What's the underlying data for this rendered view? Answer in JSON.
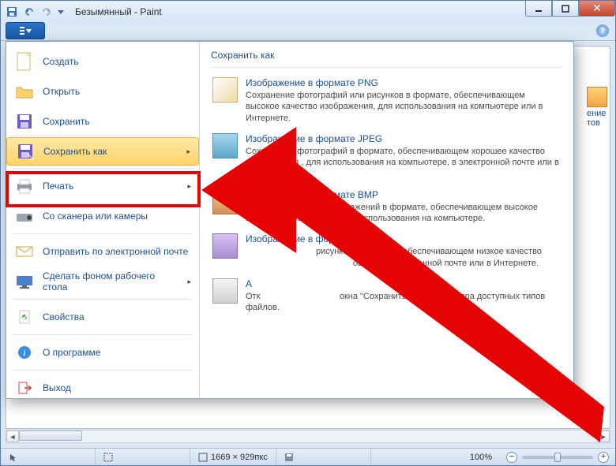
{
  "window": {
    "title": "Безымянный - Paint"
  },
  "menu": {
    "items": [
      {
        "key": "create",
        "label": "Создать"
      },
      {
        "key": "open",
        "label": "Открыть"
      },
      {
        "key": "save",
        "label": "Сохранить"
      },
      {
        "key": "saveas",
        "label": "Сохранить как",
        "hasSub": true,
        "hovered": true
      },
      {
        "key": "print",
        "label": "Печать",
        "hasSub": true
      },
      {
        "key": "scanner",
        "label": "Со сканера или камеры"
      },
      {
        "key": "email",
        "label": "Отправить по электронной почте"
      },
      {
        "key": "wallpaper",
        "label": "Сделать фоном рабочего стола",
        "hasSub": true
      },
      {
        "key": "props",
        "label": "Свойства"
      },
      {
        "key": "about",
        "label": "О программе"
      },
      {
        "key": "exit",
        "label": "Выход"
      }
    ],
    "submenu_title": "Сохранить как",
    "formats": [
      {
        "key": "png",
        "title": "Изображение в формате PNG",
        "desc": "Сохранение фотографий или рисунков в формате, обеспечивающем высокое качество изображения, для использования на компьютере или в Интернете."
      },
      {
        "key": "jpeg",
        "title": "Изображение в формате JPEG",
        "desc": "Сохранение фотографий в формате, обеспечивающем хорошее качество изображения , для использования на компьютере, в электронной почте или в Интернете."
      },
      {
        "key": "bmp",
        "title": "Изображение в формате BMP",
        "desc": "Сохранение любых изображений в формате, обеспечивающем высокое качество изображения, для использования на компьютере."
      },
      {
        "key": "gif",
        "title": "Изображение в формате GIF",
        "desc_part1": "рисунков в формате, обеспечивающем низкое качество",
        "desc_part2": "ования в электронной почте или в Интернете."
      },
      {
        "key": "other",
        "title_part1": "А",
        "desc_part1": "Отк",
        "desc_part2": "окна \"Сохранить как\" для выбора доступных типов файлов."
      }
    ]
  },
  "status": {
    "dimensions": "1669 × 929пкс",
    "zoom": "100%"
  },
  "fragments": {
    "crop1": "ение",
    "crop2": "тов"
  }
}
